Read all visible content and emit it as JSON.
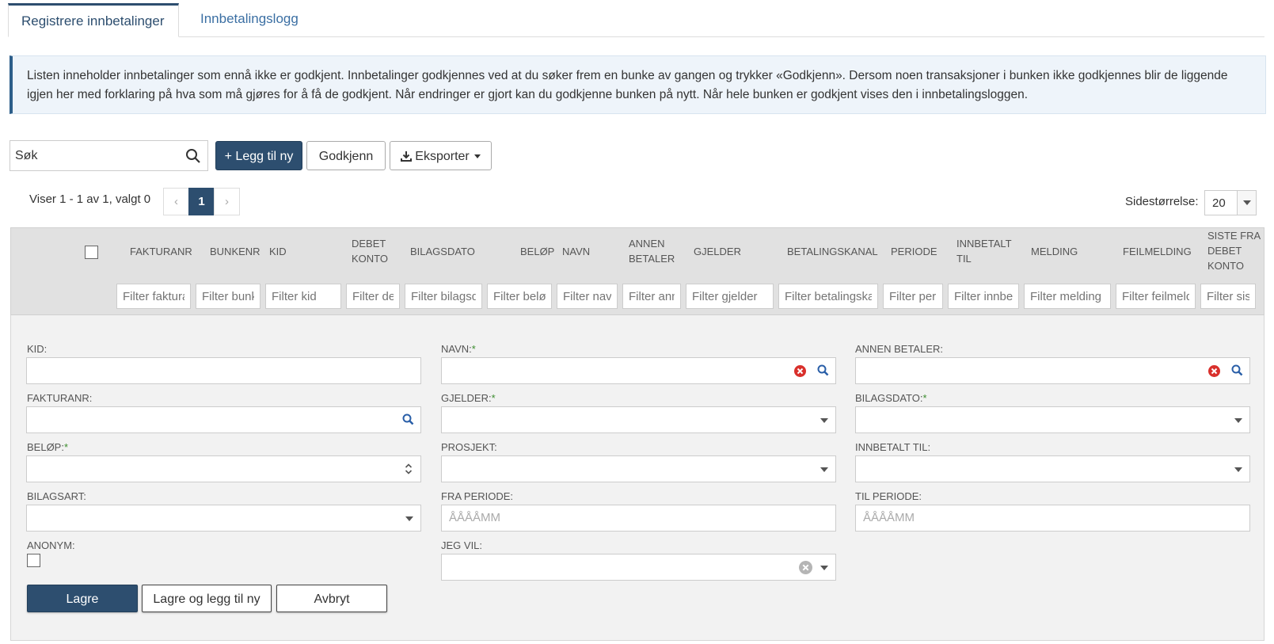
{
  "tabs": [
    {
      "label": "Registrere innbetalinger",
      "active": true
    },
    {
      "label": "Innbetalingslogg",
      "active": false
    }
  ],
  "info_text": "Listen inneholder innbetalinger som ennå ikke er godkjent. Innbetalinger godkjennes ved at du søker frem en bunke av gangen og trykker «Godkjenn». Dersom noen transaksjoner i bunken ikke godkjennes blir de liggende igjen her med forklaring på hva som må gjøres for å få de godkjent. Når endringer er gjort kan du godkjenne bunken på nytt. Når hele bunken er godkjent vises den i innbetalingsloggen.",
  "toolbar": {
    "search_placeholder": "Søk",
    "add_label": "+ Legg til ny",
    "approve_label": "Godkjenn",
    "export_label": "Eksporter"
  },
  "pager": {
    "summary": "Viser 1 - 1 av 1, valgt 0",
    "prev": "‹",
    "current": "1",
    "next": "›",
    "page_size_label": "Sidestørrelse:",
    "page_size": "20"
  },
  "grid": {
    "columns": [
      {
        "label": "FAKTURANR",
        "filter": "Filter fakturanr"
      },
      {
        "label": "BUNKENR",
        "filter": "Filter bunkenr"
      },
      {
        "label": "KID",
        "filter": "Filter kid"
      },
      {
        "label": "DEBET KONTO",
        "filter": "Filter debet konto"
      },
      {
        "label": "BILAGSDATO",
        "filter": "Filter bilagsdato"
      },
      {
        "label": "BELØP",
        "filter": "Filter beløp"
      },
      {
        "label": "NAVN",
        "filter": "Filter navn"
      },
      {
        "label": "ANNEN BETALER",
        "filter": "Filter annen betaler"
      },
      {
        "label": "GJELDER",
        "filter": "Filter gjelder"
      },
      {
        "label": "BETALINGSKANAL",
        "filter": "Filter betalingskanal"
      },
      {
        "label": "PERIODE",
        "filter": "Filter periode"
      },
      {
        "label": "INNBETALT TIL",
        "filter": "Filter innbetalt til"
      },
      {
        "label": "MELDING",
        "filter": "Filter melding"
      },
      {
        "label": "FEILMELDING",
        "filter": "Filter feilmelding"
      },
      {
        "label": "SISTE FRA DEBET KONTO",
        "filter": "Filter siste fra debet konto"
      }
    ]
  },
  "form": {
    "kid_label": "KID:",
    "navn_label": "NAVN:",
    "annen_betaler_label": "ANNEN BETALER:",
    "fakturanr_label": "FAKTURANR:",
    "gjelder_label": "GJELDER:",
    "bilagsdato_label": "BILAGSDATO:",
    "belop_label": "BELØP:",
    "prosjekt_label": "PROSJEKT:",
    "innbetalt_til_label": "INNBETALT TIL:",
    "bilagsart_label": "BILAGSART:",
    "fra_periode_label": "FRA PERIODE:",
    "til_periode_label": "TIL PERIODE:",
    "anonym_label": "ANONYM:",
    "jeg_vil_label": "JEG VIL:",
    "required_mark": "*",
    "period_placeholder": "ÅÅÅÅMM",
    "save_label": "Lagre",
    "save_new_label": "Lagre og legg til ny",
    "cancel_label": "Avbryt"
  },
  "colors": {
    "primary": "#2d4e6f",
    "link": "#3b6fa3",
    "required": "#3c8d2f",
    "clear_red": "#d9302c"
  }
}
